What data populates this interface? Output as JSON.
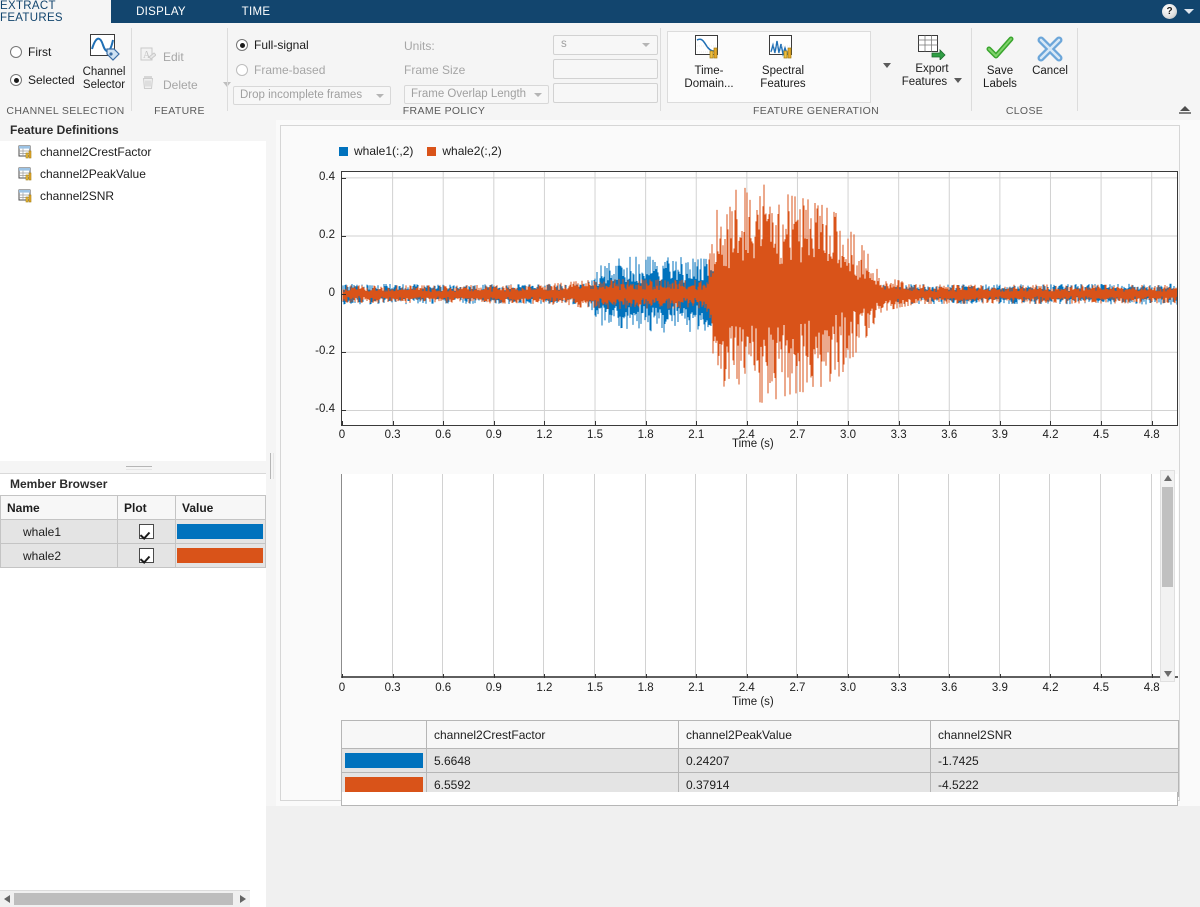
{
  "window": {
    "tabs": [
      {
        "label": "EXTRACT FEATURES",
        "active": true
      },
      {
        "label": "DISPLAY",
        "active": false
      },
      {
        "label": "TIME",
        "active": false
      }
    ],
    "help_icon": "question-mark-icon",
    "help_caret": "chevron-down-icon"
  },
  "ribbon": {
    "channel_selection": {
      "group_label": "CHANNEL SELECTION",
      "radios": [
        {
          "label": "First",
          "selected": false
        },
        {
          "label": "Selected",
          "selected": true
        }
      ],
      "channel_selector": {
        "line1": "Channel",
        "line2": "Selector",
        "icon": "channel-selector-icon"
      }
    },
    "feature": {
      "group_label": "FEATURE",
      "edit": {
        "label": "Edit",
        "icon": "edit-icon",
        "enabled": false
      },
      "delete": {
        "label": "Delete",
        "icon": "trash-icon",
        "enabled": false,
        "caret": "chevron-down-icon"
      }
    },
    "frame_policy": {
      "group_label": "FRAME POLICY",
      "signal_mode": [
        {
          "label": "Full-signal",
          "selected": true,
          "enabled": true
        },
        {
          "label": "Frame-based",
          "selected": false,
          "enabled": false
        }
      ],
      "incomplete_frames": {
        "value": "Drop incomplete frames",
        "enabled": false
      },
      "units_label": "Units:",
      "units_value": "s",
      "frame_size_label": "Frame Size",
      "frame_size_value": "",
      "frame_overlap_label": "Frame Overlap Length",
      "frame_overlap_value": ""
    },
    "feature_generation": {
      "group_label": "FEATURE GENERATION",
      "buttons": [
        {
          "line1": "Time-",
          "line2": "Domain...",
          "icon": "time-domain-features-icon"
        },
        {
          "line1": "Spectral",
          "line2": "Features",
          "icon": "spectral-features-icon"
        }
      ],
      "more_caret": "chevron-down-icon",
      "export": {
        "line1": "Export",
        "line2": "Features",
        "icon": "export-table-icon",
        "caret": "chevron-down-icon"
      }
    },
    "close": {
      "group_label": "CLOSE",
      "save_labels": {
        "line1": "Save",
        "line2": "Labels",
        "icon": "green-check-icon"
      },
      "cancel": {
        "line1": "Cancel",
        "line2": "",
        "icon": "blue-x-icon"
      }
    },
    "collapse_icon": "collapse-ribbon-icon"
  },
  "feature_definitions": {
    "title": "Feature Definitions",
    "items": [
      {
        "name": "channel2CrestFactor",
        "icon": "feature-table-icon"
      },
      {
        "name": "channel2PeakValue",
        "icon": "feature-table-icon"
      },
      {
        "name": "channel2SNR",
        "icon": "feature-table-icon"
      }
    ]
  },
  "member_browser": {
    "title": "Member Browser",
    "columns": [
      "Name",
      "Plot",
      "Value"
    ],
    "rows": [
      {
        "name": "whale1",
        "plot": true,
        "color": "#0072bd"
      },
      {
        "name": "whale2",
        "plot": true,
        "color": "#d95319"
      }
    ]
  },
  "colors": {
    "series1": "#0072bd",
    "series2": "#d95319",
    "ribbon_blue": "#12456e"
  },
  "chart_data": [
    {
      "type": "line",
      "id": "signal-plot",
      "title": "",
      "xlabel": "Time (s)",
      "ylabel": "",
      "xlim": [
        0,
        4.95
      ],
      "ylim": [
        -0.45,
        0.42
      ],
      "xticks": [
        0,
        0.3,
        0.6,
        0.9,
        1.2,
        1.5,
        1.8,
        2.1,
        2.4,
        2.7,
        3.0,
        3.3,
        3.6,
        3.9,
        4.2,
        4.5,
        4.8
      ],
      "xticklabels": [
        "0",
        "0.3",
        "0.6",
        "0.9",
        "1.2",
        "1.5",
        "1.8",
        "2.1",
        "2.4",
        "2.7",
        "3.0",
        "3.3",
        "3.6",
        "3.9",
        "4.2",
        "4.5",
        "4.8"
      ],
      "yticks": [
        -0.4,
        -0.2,
        0,
        0.2,
        0.4
      ],
      "yticklabels": [
        "-0.4",
        "-0.2",
        "0",
        "0.2",
        "0.4"
      ],
      "grid": true,
      "legend": [
        "whale1(:,2)",
        "whale2(:,2)"
      ],
      "legend_position": "above-left",
      "series": [
        {
          "name": "whale1(:,2)",
          "color": "#0072bd",
          "description": "Noisy whale call, quiet baseline with burst between 1.55 s and 2.2 s",
          "envelope_x": [
            0.0,
            0.3,
            0.6,
            0.9,
            1.2,
            1.45,
            1.55,
            1.7,
            1.9,
            2.05,
            2.18,
            2.25,
            2.6,
            3.0,
            3.4,
            3.8,
            4.2,
            4.6,
            4.95
          ],
          "envelope_pos": [
            0.035,
            0.035,
            0.032,
            0.034,
            0.033,
            0.036,
            0.115,
            0.128,
            0.13,
            0.126,
            0.12,
            0.036,
            0.034,
            0.033,
            0.034,
            0.033,
            0.034,
            0.035,
            0.036
          ],
          "envelope_neg": [
            -0.035,
            -0.035,
            -0.032,
            -0.034,
            -0.033,
            -0.036,
            -0.12,
            -0.132,
            -0.134,
            -0.13,
            -0.124,
            -0.036,
            -0.034,
            -0.033,
            -0.034,
            -0.033,
            -0.034,
            -0.035,
            -0.036
          ]
        },
        {
          "name": "whale2(:,2)",
          "color": "#d95319",
          "description": "Noisy whale call with large burst between 2.2 s and 3.2 s peaking near 0.38",
          "envelope_x": [
            0.0,
            0.3,
            0.6,
            0.9,
            1.2,
            1.45,
            1.6,
            1.9,
            2.15,
            2.22,
            2.35,
            2.5,
            2.65,
            2.8,
            2.95,
            3.1,
            3.2,
            3.4,
            3.8,
            4.2,
            4.6,
            4.95
          ],
          "envelope_pos": [
            0.03,
            0.03,
            0.03,
            0.032,
            0.034,
            0.048,
            0.052,
            0.05,
            0.048,
            0.3,
            0.37,
            0.38,
            0.34,
            0.32,
            0.27,
            0.15,
            0.06,
            0.034,
            0.032,
            0.033,
            0.032,
            0.031
          ],
          "envelope_neg": [
            -0.03,
            -0.03,
            -0.03,
            -0.032,
            -0.034,
            -0.048,
            -0.052,
            -0.05,
            -0.048,
            -0.3,
            -0.36,
            -0.375,
            -0.345,
            -0.33,
            -0.28,
            -0.15,
            -0.06,
            -0.034,
            -0.032,
            -0.033,
            -0.032,
            -0.031
          ]
        }
      ]
    },
    {
      "type": "line",
      "id": "empty-plot",
      "title": "",
      "xlabel": "Time (s)",
      "ylabel": "",
      "xlim": [
        0,
        4.95
      ],
      "xticks": [
        0,
        0.3,
        0.6,
        0.9,
        1.2,
        1.5,
        1.8,
        2.1,
        2.4,
        2.7,
        3.0,
        3.3,
        3.6,
        3.9,
        4.2,
        4.5,
        4.8
      ],
      "xticklabels": [
        "0",
        "0.3",
        "0.6",
        "0.9",
        "1.2",
        "1.5",
        "1.8",
        "2.1",
        "2.4",
        "2.7",
        "3.0",
        "3.3",
        "3.6",
        "3.9",
        "4.2",
        "4.5",
        "4.8"
      ],
      "yticks": [],
      "yticklabels": [],
      "grid": true,
      "series": []
    }
  ],
  "feature_table": {
    "columns": [
      "",
      "channel2CrestFactor",
      "channel2PeakValue",
      "channel2SNR"
    ],
    "rows": [
      {
        "color": "#0072bd",
        "channel2CrestFactor": "5.6648",
        "channel2PeakValue": "0.24207",
        "channel2SNR": "-1.7425"
      },
      {
        "color": "#d95319",
        "channel2CrestFactor": "6.5592",
        "channel2PeakValue": "0.37914",
        "channel2SNR": "-4.5222"
      }
    ]
  }
}
